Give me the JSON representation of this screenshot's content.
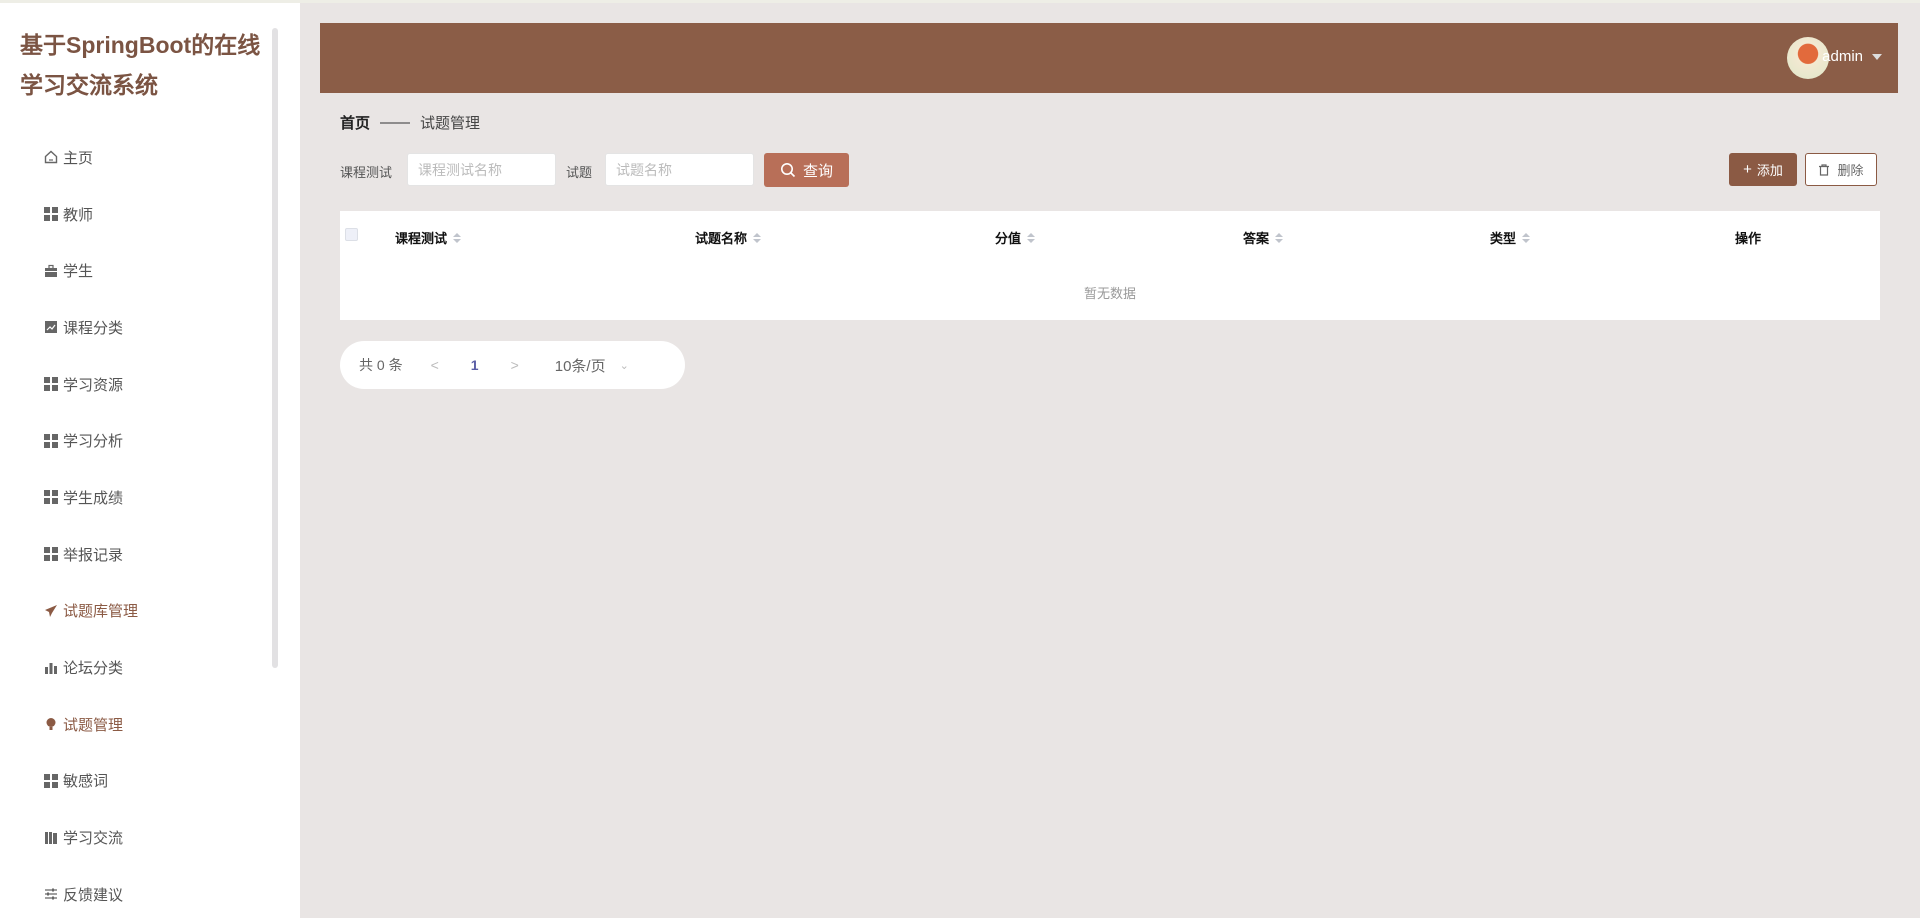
{
  "app": {
    "title": "基于SpringBoot的在线学习交流系统"
  },
  "sidebar": {
    "items": [
      {
        "label": "主页",
        "icon": "home-icon"
      },
      {
        "label": "教师",
        "icon": "grid-icon"
      },
      {
        "label": "学生",
        "icon": "briefcase-icon"
      },
      {
        "label": "课程分类",
        "icon": "chart-icon"
      },
      {
        "label": "学习资源",
        "icon": "grid-icon"
      },
      {
        "label": "学习分析",
        "icon": "grid-icon"
      },
      {
        "label": "学生成绩",
        "icon": "grid-icon"
      },
      {
        "label": "举报记录",
        "icon": "grid-icon"
      },
      {
        "label": "试题库管理",
        "icon": "paper-plane-icon"
      },
      {
        "label": "论坛分类",
        "icon": "bar-chart-icon"
      },
      {
        "label": "试题管理",
        "icon": "bulb-icon"
      },
      {
        "label": "敏感词",
        "icon": "grid-icon"
      },
      {
        "label": "学习交流",
        "icon": "books-icon"
      },
      {
        "label": "反馈建议",
        "icon": "sliders-icon"
      }
    ]
  },
  "header": {
    "user": "admin"
  },
  "breadcrumb": {
    "home": "首页",
    "sep": "——",
    "current": "试题管理"
  },
  "search": {
    "label1": "课程测试",
    "placeholder1": "课程测试名称",
    "value1": "",
    "label2": "试题",
    "placeholder2": "试题名称",
    "value2": "",
    "query": "查询"
  },
  "actions": {
    "add": "添加",
    "delete": "删除"
  },
  "table": {
    "columns": [
      "课程测试",
      "试题名称",
      "分值",
      "答案",
      "类型",
      "操作"
    ],
    "empty": "暂无数据",
    "rows": []
  },
  "pagination": {
    "total": "共 0 条",
    "prev": "<",
    "page": "1",
    "next": ">",
    "size": "10条/页"
  },
  "colors": {
    "header": "#8b5d47",
    "accent": "#8b5a44",
    "query_button": "#b86f58",
    "background": "#e9e5e4"
  }
}
